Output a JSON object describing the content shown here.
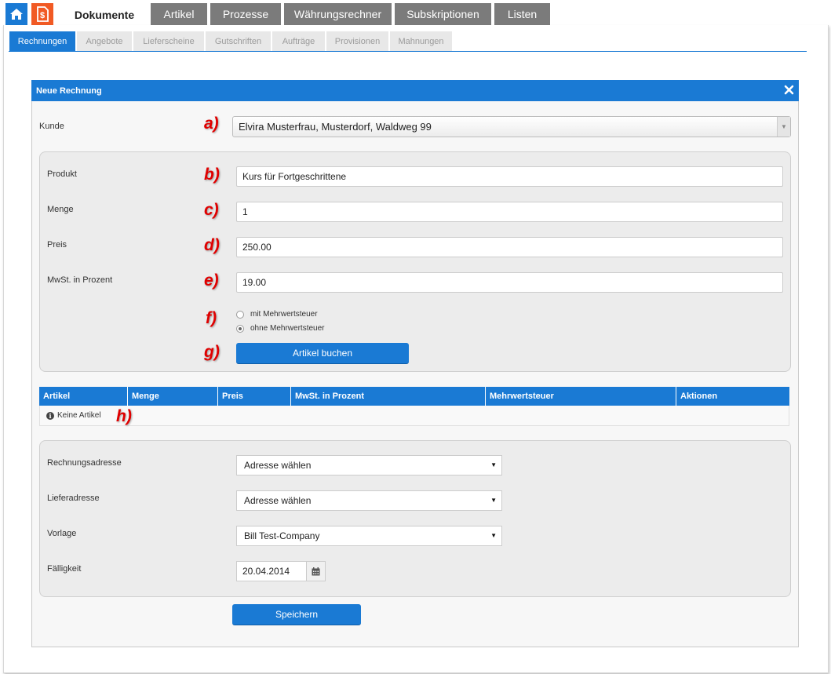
{
  "topnav": {
    "home_icon": "home-icon",
    "doc_icon": "invoice-icon",
    "tabs": [
      "Dokumente",
      "Artikel",
      "Prozesse",
      "Währungsrechner",
      "Subskriptionen",
      "Listen"
    ]
  },
  "subnav": {
    "tabs": [
      "Rechnungen",
      "Angebote",
      "Lieferscheine",
      "Gutschriften",
      "Aufträge",
      "Provisionen",
      "Mahnungen"
    ]
  },
  "dialog": {
    "title": "Neue Rechnung",
    "close_icon": "close-icon"
  },
  "form": {
    "kunde_label": "Kunde",
    "kunde_value": "Elvira Musterfrau, Musterdorf, Waldweg 99",
    "produkt_label": "Produkt",
    "produkt_value": "Kurs für Fortgeschrittene",
    "menge_label": "Menge",
    "menge_value": "1",
    "preis_label": "Preis",
    "preis_value": "250.00",
    "mwst_label": "MwSt. in Prozent",
    "mwst_value": "19.00",
    "radio_mit": "mit Mehrwertsteuer",
    "radio_ohne": "ohne Mehrwertsteuer",
    "radio_selected": "ohne Mehrwertsteuer",
    "book_button": "Artikel buchen"
  },
  "markers": {
    "a": "a)",
    "b": "b)",
    "c": "c)",
    "d": "d)",
    "e": "e)",
    "f": "f)",
    "g": "g)",
    "h": "h)"
  },
  "table": {
    "headers": [
      "Artikel",
      "Menge",
      "Preis",
      "MwSt. in Prozent",
      "Mehrwertsteuer",
      "Aktionen"
    ],
    "empty_text": "Keine Artikel"
  },
  "address": {
    "rechnung_label": "Rechnungsadresse",
    "rechnung_value": "Adresse wählen",
    "liefer_label": "Lieferadresse",
    "liefer_value": "Adresse wählen",
    "vorlage_label": "Vorlage",
    "vorlage_value": "Bill Test-Company",
    "faellig_label": "Fälligkeit",
    "faellig_value": "20.04.2014",
    "calendar_icon": "calendar-icon"
  },
  "save_button": "Speichern",
  "colors": {
    "primary": "#1a7ad4",
    "tab_gray": "#7b7b7b",
    "doc_orange": "#f15a24",
    "marker_red": "#e00000"
  }
}
